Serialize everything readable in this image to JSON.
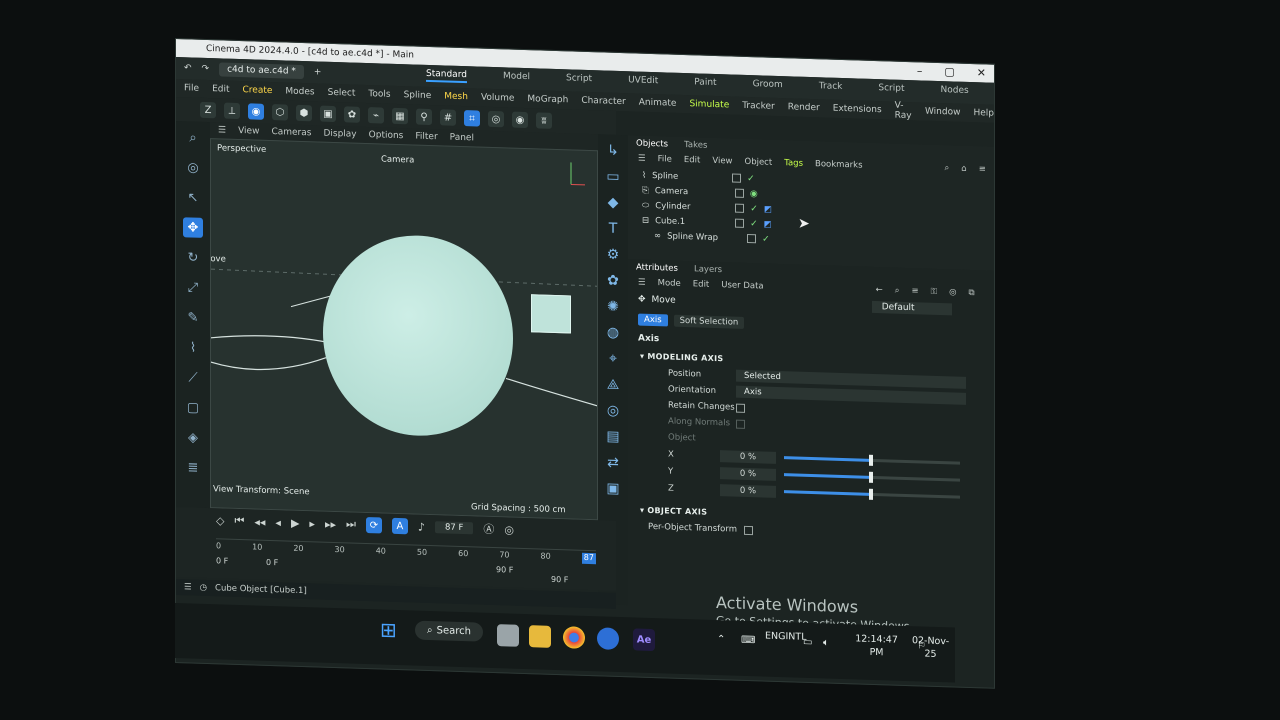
{
  "window": {
    "title": "Cinema 4D 2024.4.0 - [c4d to ae.c4d *] - Main",
    "doc_tab": "c4d to ae.c4d *",
    "add_tab": "+",
    "controls": [
      "–",
      "▢",
      "✕"
    ]
  },
  "layouts": [
    "Standard",
    "Model",
    "Script",
    "UVEdit",
    "Paint",
    "Groom",
    "Track",
    "Script",
    "Nodes"
  ],
  "menu": [
    "File",
    "Edit",
    "Create",
    "Modes",
    "Select",
    "Tools",
    "Spline",
    "Mesh",
    "Volume",
    "MoGraph",
    "Character",
    "Animate",
    "Simulate",
    "Tracker",
    "Render",
    "Extensions",
    "V-Ray",
    "Window",
    "Help"
  ],
  "viewport": {
    "menu": [
      "View",
      "Cameras",
      "Display",
      "Options",
      "Filter",
      "Panel"
    ],
    "label": "Perspective",
    "camera": "Camera",
    "move_label": "Move",
    "view_transform": "View Transform: Scene",
    "grid_spacing": "Grid Spacing : 500 cm"
  },
  "timeline": {
    "current_frame": "87 F",
    "ticks": [
      "0",
      "10",
      "20",
      "30",
      "40",
      "50",
      "60",
      "70",
      "80"
    ],
    "start": "0 F",
    "start2": "0 F",
    "end": "90 F",
    "end2": "90 F",
    "playhead": "87"
  },
  "status": {
    "text": "Cube Object [Cube.1]"
  },
  "objects_panel": {
    "tabs": [
      "Objects",
      "Takes"
    ],
    "menu": [
      "File",
      "Edit",
      "View",
      "Object",
      "Tags",
      "Bookmarks"
    ],
    "items": [
      {
        "name": "Spline",
        "flags": "✓"
      },
      {
        "name": "Camera",
        "flags": "◉"
      },
      {
        "name": "Cylinder",
        "flags": "✓"
      },
      {
        "name": "Cube.1",
        "flags": "✓"
      },
      {
        "name": "Spline Wrap",
        "flags": "✓"
      }
    ]
  },
  "attributes_panel": {
    "tabs": [
      "Attributes",
      "Layers"
    ],
    "menu": [
      "Mode",
      "Edit",
      "User Data"
    ],
    "tool": "Move",
    "preset": "Default",
    "chips": [
      "Axis",
      "Soft Selection"
    ],
    "heading": "Axis",
    "modeling_axis": "MODELING AXIS",
    "position_label": "Position",
    "position_value": "Selected",
    "orientation_label": "Orientation",
    "orientation_value": "Axis",
    "retain_label": "Retain Changes",
    "along_normals_label": "Along Normals",
    "object_label": "Object",
    "axes": [
      {
        "label": "X",
        "value": "0 %",
        "level": 0
      },
      {
        "label": "Y",
        "value": "0 %",
        "level": 0
      },
      {
        "label": "Z",
        "value": "0 %",
        "level": 0
      }
    ],
    "object_axis": "OBJECT AXIS",
    "per_object_label": "Per-Object Transform"
  },
  "watermark": {
    "line1": "Activate Windows",
    "line2": "Go to Settings to activate Windows."
  },
  "taskbar": {
    "search": "Search",
    "lang1": "ENG",
    "lang2": "INTL",
    "time": "12:14:47 PM",
    "date": "02-Nov-25",
    "ae_label": "Ae"
  },
  "colors": {
    "accent": "#2f7fe0",
    "menu_highlight": "#ffd84a",
    "tag_highlight": "#c7ff4a"
  }
}
